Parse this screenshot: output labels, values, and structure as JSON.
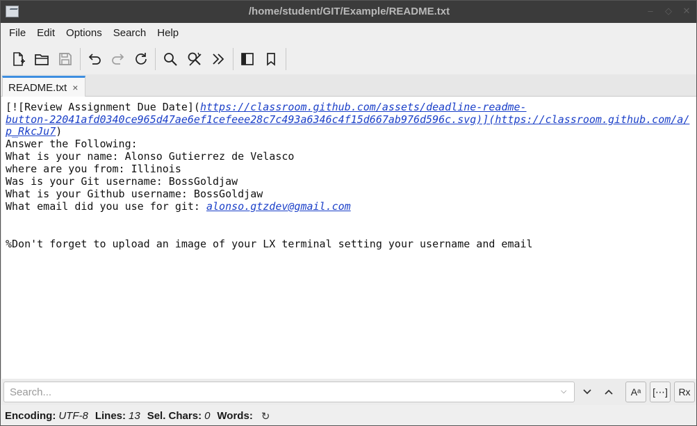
{
  "window": {
    "title": "/home/student/GIT/Example/README.txt",
    "controls": [
      "–",
      "◇",
      "✕"
    ]
  },
  "menubar": {
    "items": [
      "File",
      "Edit",
      "Options",
      "Search",
      "Help"
    ]
  },
  "toolbar": {
    "icons": [
      "new-document-icon",
      "open-folder-icon",
      "save-icon",
      "undo-icon",
      "redo-icon",
      "reload-icon",
      "find-icon",
      "replace-icon",
      "more-icon",
      "side-pane-icon",
      "bookmark-icon"
    ]
  },
  "tabs": [
    {
      "label": "README.txt",
      "close": "×"
    }
  ],
  "editor": {
    "lines": [
      {
        "text": "[![Review Assignment Due Date](",
        "link": "https://classroom.github.com/assets/deadline-readme-"
      },
      {
        "link": "button-22041afd0340ce965d47ae6ef1cefeee28c7c493a6346c4f15d667ab976d596c.svg)](https://classroom.github.com/a/"
      },
      {
        "link": "p_RkcJu7",
        "text_after": ")"
      },
      {
        "text": "Answer the Following:"
      },
      {
        "text": "What is your name: Alonso Gutierrez de Velasco"
      },
      {
        "text": "where are you from: Illinois"
      },
      {
        "text": "Was is your Git username: BossGoldjaw"
      },
      {
        "text": "What is your Github username: BossGoldjaw"
      },
      {
        "text": "What email did you use for git: ",
        "link": "alonso.gtzdev@gmail.com"
      },
      {
        "text": ""
      },
      {
        "text": ""
      },
      {
        "text": "%Don't forget to upload an image of your LX terminal setting your username and email"
      }
    ]
  },
  "search": {
    "placeholder": "Search...",
    "down_arrow": "⌄",
    "up_arrow": "⌃",
    "case_toggle": "Aᵃ",
    "whole_word_toggle": "[⋯]",
    "regex_toggle": "Rx"
  },
  "status": {
    "encoding_label": "Encoding:",
    "encoding_value": "UTF-8",
    "lines_label": "Lines:",
    "lines_value": "13",
    "selchars_label": "Sel. Chars:",
    "selchars_value": "0",
    "words_label": "Words:",
    "refresh_icon": "↻"
  },
  "colors": {
    "titlebar": "#3b3b3b",
    "tab_accent": "#3d8ee0",
    "link": "#1a3fc8"
  }
}
